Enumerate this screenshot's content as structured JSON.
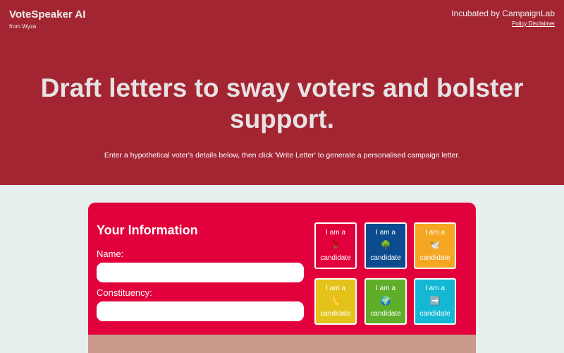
{
  "header": {
    "brand_title": "VoteSpeaker AI",
    "brand_sub": "from Wyza",
    "incubated_text": "Incubated by CampaignLab",
    "policy_link": "Policy Disclaimer"
  },
  "hero": {
    "headline": "Draft letters to sway voters and bolster support.",
    "intro": "Enter a hypothetical voter's details below, then click 'Write Letter' to generate a personalised campaign letter."
  },
  "form": {
    "title": "Your Information",
    "name_label": "Name:",
    "name_value": "",
    "constituency_label": "Constituency:",
    "constituency_value": ""
  },
  "candidates": [
    {
      "top": "I am a",
      "emoji": "🌹",
      "bottom": "candidate",
      "color": "#e2003c",
      "icon": "rose-icon"
    },
    {
      "top": "I am a",
      "emoji": "🌳",
      "bottom": "candidate",
      "color": "#0c4b8e",
      "icon": "tree-icon"
    },
    {
      "top": "I am a",
      "emoji": "🕊️",
      "bottom": "candidate",
      "color": "#f5a623",
      "icon": "dove-icon"
    },
    {
      "top": "I am a",
      "emoji": "🎗️",
      "bottom": "candidate",
      "color": "#e3c21c",
      "icon": "ribbon-icon"
    },
    {
      "top": "I am a",
      "emoji": "🌍",
      "bottom": "candidate",
      "color": "#5fae2a",
      "icon": "globe-icon"
    },
    {
      "top": "I am a",
      "emoji": "➡️",
      "bottom": "candidate",
      "color": "#14b8d4",
      "icon": "right-arrow-icon"
    }
  ]
}
